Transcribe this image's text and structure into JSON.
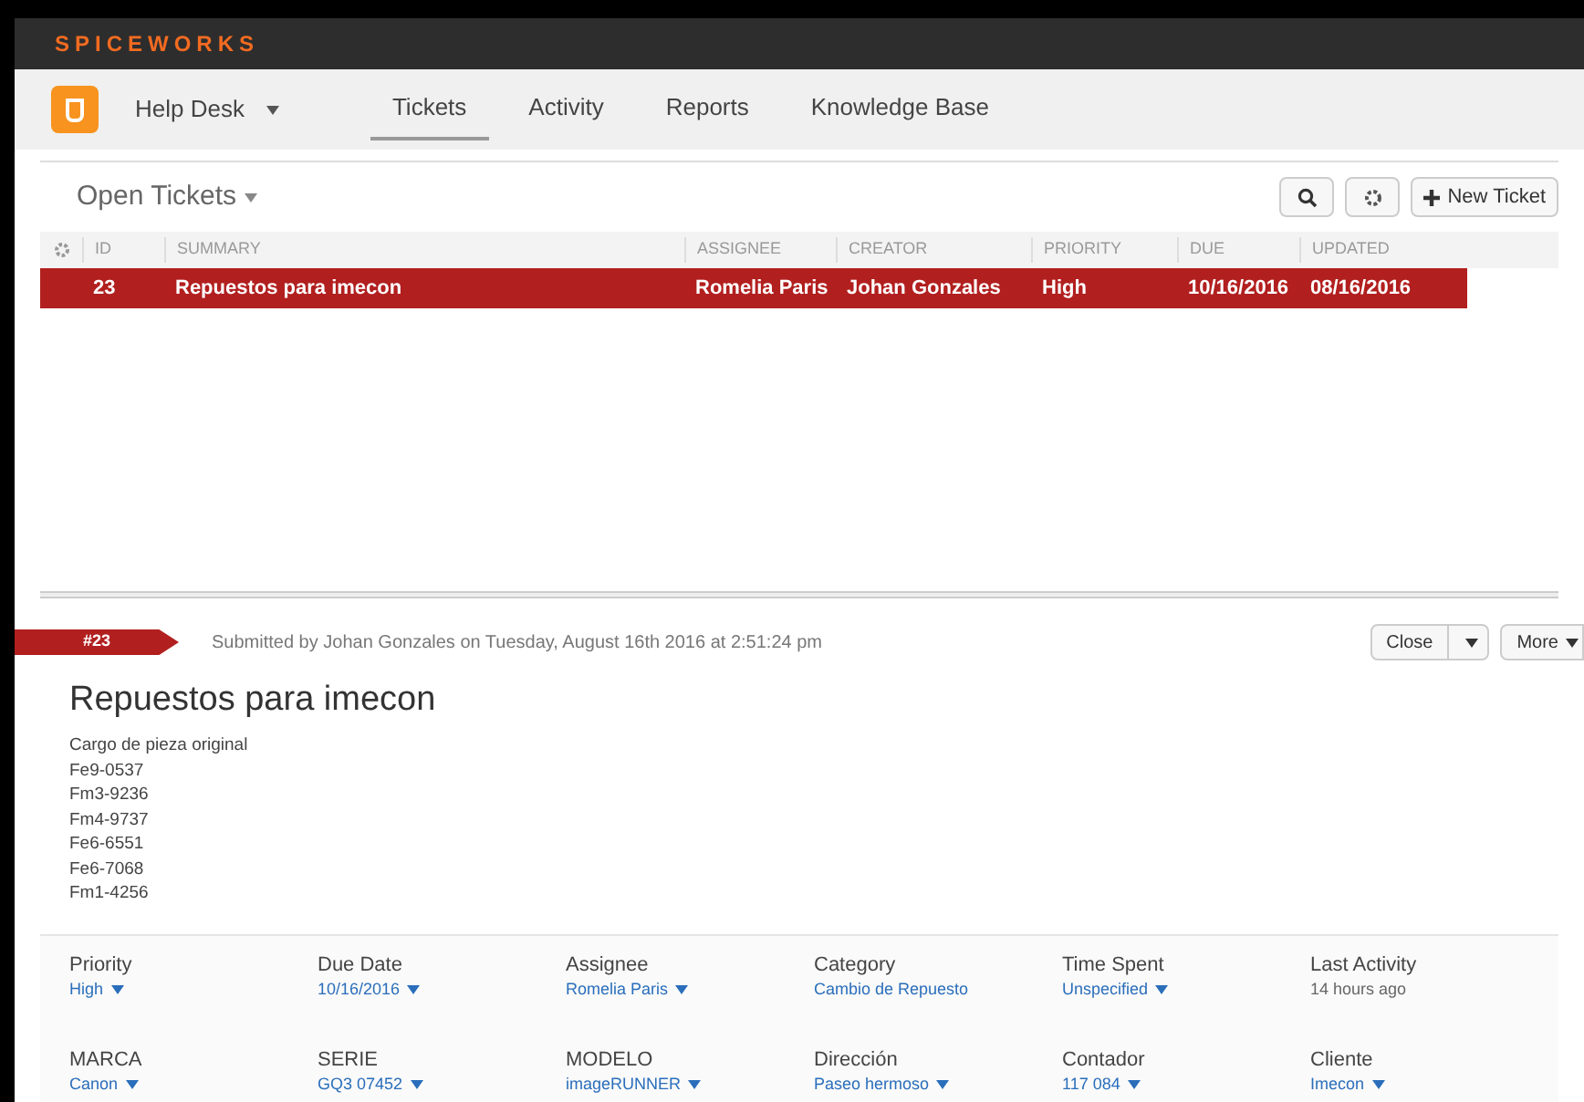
{
  "logo": "SPICEWORKS",
  "app": {
    "name": "Help Desk"
  },
  "tabs": [
    {
      "label": "Tickets",
      "selected": true
    },
    {
      "label": "Activity",
      "selected": false
    },
    {
      "label": "Reports",
      "selected": false
    },
    {
      "label": "Knowledge Base",
      "selected": false
    }
  ],
  "list": {
    "title": "Open Tickets",
    "new_button": "New Ticket",
    "columns": [
      "ID",
      "SUMMARY",
      "ASSIGNEE",
      "CREATOR",
      "PRIORITY",
      "DUE",
      "UPDATED"
    ],
    "rows": [
      {
        "selected": true,
        "cells": [
          "23",
          "Repuestos para imecon",
          "Romelia Paris",
          "Johan Gonzales",
          "High",
          "10/16/2016",
          "08/16/2016"
        ]
      }
    ]
  },
  "ticket": {
    "number": "#23",
    "submitted": "Submitted by Johan Gonzales on Tuesday, August 16th 2016 at 2:51:24 pm",
    "buttons": [
      "Close",
      "More"
    ],
    "title": "Repuestos para imecon",
    "body": [
      "Cargo de pieza original",
      "Fe9-0537",
      "Fm3-9236",
      "Fm4-9737",
      "Fe6-6551",
      "Fe6-7068",
      "Fm1-4256"
    ],
    "fields": [
      {
        "label": "Priority",
        "value": "High",
        "kind": "dropdown"
      },
      {
        "label": "Due Date",
        "value": "10/16/2016",
        "kind": "dropdown"
      },
      {
        "label": "Assignee",
        "value": "Romelia Paris",
        "kind": "dropdown"
      },
      {
        "label": "Category",
        "value": "Cambio de Repuesto",
        "kind": "link"
      },
      {
        "label": "Time Spent",
        "value": "Unspecified",
        "kind": "dropdown"
      },
      {
        "label": "Last Activity",
        "value": "14 hours ago",
        "kind": "text"
      },
      {
        "label": "MARCA",
        "value": "Canon",
        "kind": "dropdown"
      },
      {
        "label": "SERIE",
        "value": "GQ3 07452",
        "kind": "dropdown"
      },
      {
        "label": "MODELO",
        "value": "imageRUNNER",
        "kind": "dropdown"
      },
      {
        "label": "Dirección",
        "value": "Paseo hermoso",
        "kind": "dropdown"
      },
      {
        "label": "Contador",
        "value": "117 084",
        "kind": "dropdown"
      },
      {
        "label": "Cliente",
        "value": "Imecon",
        "kind": "dropdown"
      }
    ]
  }
}
